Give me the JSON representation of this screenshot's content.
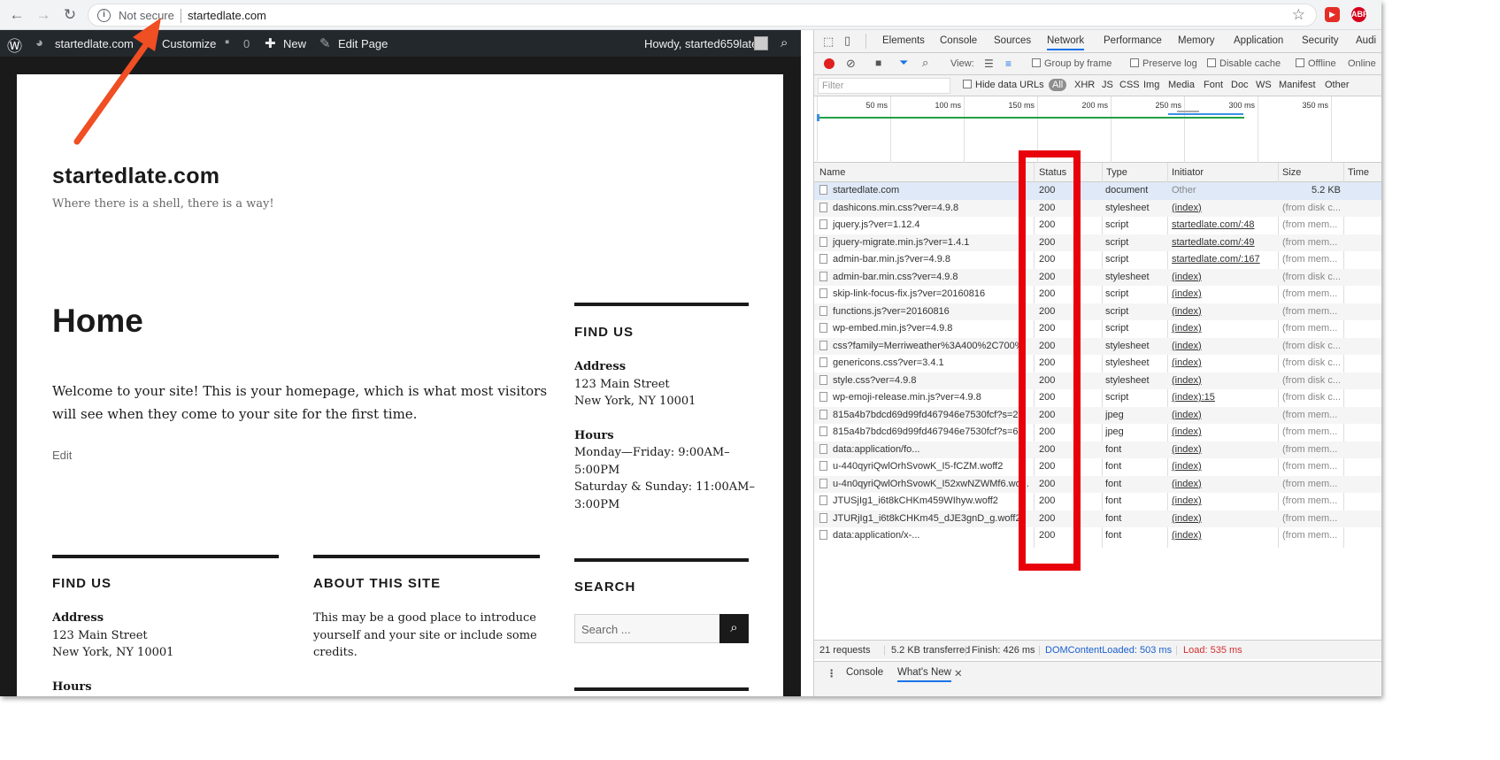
{
  "browser": {
    "security_text": "Not secure",
    "url": "startedlate.com",
    "nav": {
      "back": "←",
      "forward": "→",
      "reload": "↻"
    },
    "extensions": [
      "ext-red-icon",
      "abp-icon"
    ],
    "abp_label": "ABP"
  },
  "wp": {
    "adminbar": {
      "site": "startedlate.com",
      "customize": "Customize",
      "comments": "0",
      "new": "New",
      "edit_page": "Edit Page",
      "howdy": "Howdy, started659late"
    },
    "site_title": "startedlate.com",
    "tagline": "Where there is a shell, there is a way!",
    "page_title": "Home",
    "welcome": "Welcome to your site! This is your homepage, which is what most visitors will see when they come to your site for the first time.",
    "edit": "Edit",
    "sidebar_find_us": {
      "title": "FIND US",
      "address_label": "Address",
      "address_line1": "123 Main Street",
      "address_line2": "New York, NY 10001",
      "hours_label": "Hours",
      "hours_line1": "Monday—Friday: 9:00AM–",
      "hours_line2": "5:00PM",
      "hours_line3": "Saturday & Sunday: 11:00AM–",
      "hours_line4": "3:00PM"
    },
    "footer_find_us": {
      "title": "FIND US",
      "address_label": "Address",
      "address_line1": "123 Main Street",
      "address_line2": "New York, NY 10001",
      "hours_label": "Hours"
    },
    "about": {
      "title": "ABOUT THIS SITE",
      "line1": "This may be a good place to introduce",
      "line2": "yourself and your site or include some",
      "line3": "credits."
    },
    "search": {
      "title": "SEARCH",
      "placeholder": "Search ..."
    }
  },
  "devtools": {
    "tabs": [
      "Elements",
      "Console",
      "Sources",
      "Network",
      "Performance",
      "Memory",
      "Application",
      "Security",
      "Audi"
    ],
    "active_tab": "Network",
    "toolbar": {
      "view": "View:",
      "group_by_frame": "Group by frame",
      "preserve_log": "Preserve log",
      "disable_cache": "Disable cache",
      "offline": "Offline",
      "online": "Online"
    },
    "filter": {
      "placeholder": "Filter",
      "hide_data_urls": "Hide data URLs",
      "types": [
        "All",
        "XHR",
        "JS",
        "CSS",
        "Img",
        "Media",
        "Font",
        "Doc",
        "WS",
        "Manifest",
        "Other"
      ]
    },
    "timeline_ticks": [
      "50 ms",
      "100 ms",
      "150 ms",
      "200 ms",
      "250 ms",
      "300 ms",
      "350 ms"
    ],
    "columns": [
      "Name",
      "Status",
      "Type",
      "Initiator",
      "Size",
      "Time"
    ],
    "rows": [
      {
        "name": "startedlate.com",
        "status": "200",
        "type": "document",
        "initiator": "Other",
        "size": "5.2 KB"
      },
      {
        "name": "dashicons.min.css?ver=4.9.8",
        "status": "200",
        "type": "stylesheet",
        "initiator": "(index)",
        "size": "(from disk c..."
      },
      {
        "name": "jquery.js?ver=1.12.4",
        "status": "200",
        "type": "script",
        "initiator": "startedlate.com/:48",
        "size": "(from mem..."
      },
      {
        "name": "jquery-migrate.min.js?ver=1.4.1",
        "status": "200",
        "type": "script",
        "initiator": "startedlate.com/:49",
        "size": "(from mem..."
      },
      {
        "name": "admin-bar.min.js?ver=4.9.8",
        "status": "200",
        "type": "script",
        "initiator": "startedlate.com/:167",
        "size": "(from mem..."
      },
      {
        "name": "admin-bar.min.css?ver=4.9.8",
        "status": "200",
        "type": "stylesheet",
        "initiator": "(index)",
        "size": "(from disk c..."
      },
      {
        "name": "skip-link-focus-fix.js?ver=20160816",
        "status": "200",
        "type": "script",
        "initiator": "(index)",
        "size": "(from mem..."
      },
      {
        "name": "functions.js?ver=20160816",
        "status": "200",
        "type": "script",
        "initiator": "(index)",
        "size": "(from mem..."
      },
      {
        "name": "wp-embed.min.js?ver=4.9.8",
        "status": "200",
        "type": "script",
        "initiator": "(index)",
        "size": "(from mem..."
      },
      {
        "name": "css?family=Merriweather%3A400%2C700%",
        "status": "200",
        "type": "stylesheet",
        "initiator": "(index)",
        "size": "(from disk c..."
      },
      {
        "name": "genericons.css?ver=3.4.1",
        "status": "200",
        "type": "stylesheet",
        "initiator": "(index)",
        "size": "(from disk c..."
      },
      {
        "name": "style.css?ver=4.9.8",
        "status": "200",
        "type": "stylesheet",
        "initiator": "(index)",
        "size": "(from disk c..."
      },
      {
        "name": "wp-emoji-release.min.js?ver=4.9.8",
        "status": "200",
        "type": "script",
        "initiator": "(index):15",
        "size": "(from disk c..."
      },
      {
        "name": "815a4b7bdcd69d99fd467946e7530fcf?s=2...",
        "status": "200",
        "type": "jpeg",
        "initiator": "(index)",
        "size": "(from mem..."
      },
      {
        "name": "815a4b7bdcd69d99fd467946e7530fcf?s=6...",
        "status": "200",
        "type": "jpeg",
        "initiator": "(index)",
        "size": "(from mem..."
      },
      {
        "name": "data:application/fo...",
        "status": "200",
        "type": "font",
        "initiator": "(index)",
        "size": "(from mem..."
      },
      {
        "name": "u-440qyriQwlOrhSvowK_I5-fCZM.woff2",
        "status": "200",
        "type": "font",
        "initiator": "(index)",
        "size": "(from mem..."
      },
      {
        "name": "u-4n0qyriQwlOrhSvowK_I52xwNZWMf6.wo...",
        "status": "200",
        "type": "font",
        "initiator": "(index)",
        "size": "(from mem..."
      },
      {
        "name": "JTUSjIg1_i6t8kCHKm459WIhyw.woff2",
        "status": "200",
        "type": "font",
        "initiator": "(index)",
        "size": "(from mem..."
      },
      {
        "name": "JTURjIg1_i6t8kCHKm45_dJE3gnD_g.woff2",
        "status": "200",
        "type": "font",
        "initiator": "(index)",
        "size": "(from mem..."
      },
      {
        "name": "data:application/x-...",
        "status": "200",
        "type": "font",
        "initiator": "(index)",
        "size": "(from mem..."
      }
    ],
    "summary": {
      "requests": "21 requests",
      "transferred": "5.2 KB transferred",
      "finish": "Finish: 426 ms",
      "dcl": "DOMContentLoaded: 503 ms",
      "load": "Load: 535 ms"
    },
    "drawer": {
      "console": "Console",
      "whats_new": "What's New"
    }
  },
  "colors": {
    "annotation_red": "#e8000a",
    "arrow": "#f04e23",
    "devtools_blue": "#1a73e8"
  }
}
